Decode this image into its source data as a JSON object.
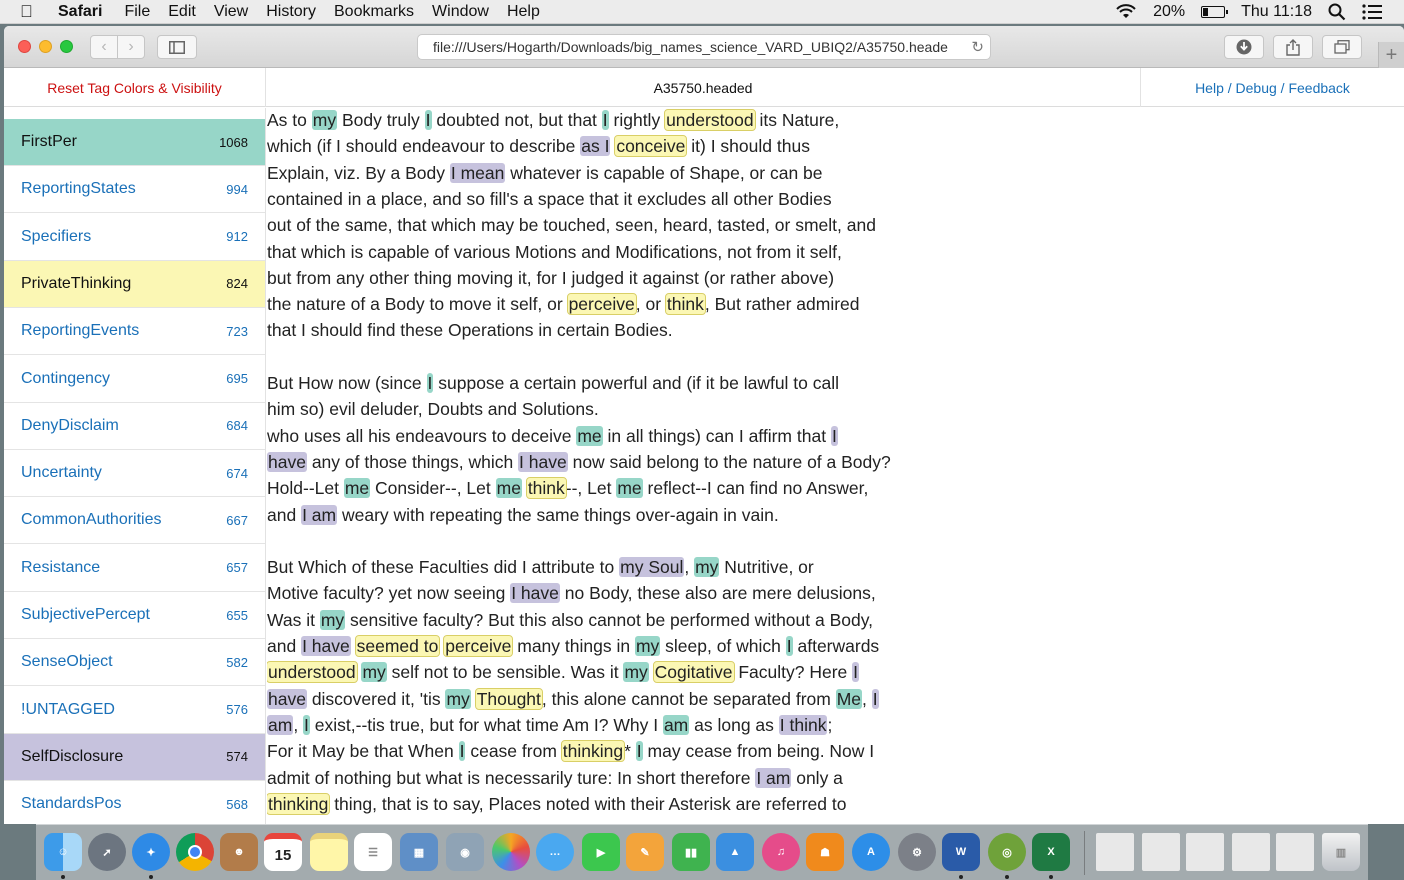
{
  "menubar": {
    "app": "Safari",
    "items": [
      "File",
      "Edit",
      "View",
      "History",
      "Bookmarks",
      "Window",
      "Help"
    ],
    "battery": "20%",
    "clock": "Thu 11:18"
  },
  "toolbar": {
    "url": "file:///Users/Hogarth/Downloads/big_names_science_VARD_UBIQ2/A35750.heade"
  },
  "page": {
    "reset_label": "Reset Tag Colors & Visibility",
    "title": "A35750.headed",
    "help_label": "Help / Debug / Feedback"
  },
  "colors": {
    "teal": "#97d6c8",
    "yellow": "#fbf7b4",
    "lavender": "#c6c2dd",
    "link": "#1a70b8",
    "reset": "#cc1111"
  },
  "tags": [
    {
      "name": "FirstPer",
      "count": "1068",
      "color": "#97d6c8"
    },
    {
      "name": "ReportingStates",
      "count": "994",
      "color": ""
    },
    {
      "name": "Specifiers",
      "count": "912",
      "color": ""
    },
    {
      "name": "PrivateThinking",
      "count": "824",
      "color": "#fbf7b4"
    },
    {
      "name": "ReportingEvents",
      "count": "723",
      "color": ""
    },
    {
      "name": "Contingency",
      "count": "695",
      "color": ""
    },
    {
      "name": "DenyDisclaim",
      "count": "684",
      "color": ""
    },
    {
      "name": "Uncertainty",
      "count": "674",
      "color": ""
    },
    {
      "name": "CommonAuthorities",
      "count": "667",
      "color": ""
    },
    {
      "name": "Resistance",
      "count": "657",
      "color": ""
    },
    {
      "name": "SubjectivePercept",
      "count": "655",
      "color": ""
    },
    {
      "name": "SenseObject",
      "count": "582",
      "color": ""
    },
    {
      "name": "!UNTAGGED",
      "count": "576",
      "color": ""
    },
    {
      "name": "SelfDisclosure",
      "count": "574",
      "color": "#c6c2dd"
    },
    {
      "name": "StandardsPos",
      "count": "568",
      "color": ""
    }
  ],
  "text_lines": [
    [
      [
        "As to ",
        ""
      ],
      [
        "my",
        "teal"
      ],
      [
        " Body truly ",
        ""
      ],
      [
        "I",
        "teal"
      ],
      [
        " doubted not, but that ",
        ""
      ],
      [
        "I",
        "teal"
      ],
      [
        " rightly ",
        ""
      ],
      [
        "understood",
        "yellow"
      ],
      [
        " its Nature,",
        ""
      ]
    ],
    [
      [
        "which (if I should endeavour to describe ",
        ""
      ],
      [
        "as I",
        "lav"
      ],
      [
        " ",
        ""
      ],
      [
        "conceive",
        "yellow"
      ],
      [
        " it) I should thus",
        ""
      ]
    ],
    [
      [
        "Explain, viz. By a Body ",
        ""
      ],
      [
        "I mean",
        "lav"
      ],
      [
        " whatever is capable of Shape, or can be",
        ""
      ]
    ],
    [
      [
        "contained in a place, and so fill's a space that it excludes all other Bodies",
        ""
      ]
    ],
    [
      [
        "out of the same, that which may be touched, seen, heard, tasted, or smelt, and",
        ""
      ]
    ],
    [
      [
        "that which is capable of various Motions and Modifications, not from it self,",
        ""
      ]
    ],
    [
      [
        "but from any other thing moving it, for I judged it against (or rather above)",
        ""
      ]
    ],
    [
      [
        "the nature of a Body to move it self, or ",
        ""
      ],
      [
        "perceive",
        "yellow"
      ],
      [
        ", or ",
        ""
      ],
      [
        "think",
        "yellow"
      ],
      [
        ", But rather admired",
        ""
      ]
    ],
    [
      [
        "that I should find these Operations in certain Bodies.",
        ""
      ]
    ],
    [],
    [
      [
        "But How now (since ",
        ""
      ],
      [
        "I",
        "teal"
      ],
      [
        " suppose a certain powerful and (if it be lawful to call",
        ""
      ]
    ],
    [
      [
        "him so) evil deluder, Doubts and Solutions.",
        ""
      ]
    ],
    [
      [
        "who uses all his endeavours to deceive ",
        ""
      ],
      [
        "me",
        "teal"
      ],
      [
        " in all things) can I affirm that ",
        ""
      ],
      [
        "I",
        "lav"
      ]
    ],
    [
      [
        "have",
        "lav"
      ],
      [
        " any of those things, which ",
        ""
      ],
      [
        "I have",
        "lav"
      ],
      [
        " now said belong to the nature of a Body?",
        ""
      ]
    ],
    [
      [
        "Hold--Let ",
        ""
      ],
      [
        "me",
        "teal"
      ],
      [
        " Consider--, Let ",
        ""
      ],
      [
        "me",
        "teal"
      ],
      [
        " ",
        ""
      ],
      [
        "think",
        "yellow"
      ],
      [
        "--, Let ",
        ""
      ],
      [
        "me",
        "teal"
      ],
      [
        " reflect--I can find no Answer,",
        ""
      ]
    ],
    [
      [
        "and ",
        ""
      ],
      [
        "I am",
        "lav"
      ],
      [
        " weary with repeating the same things over-again in vain.",
        ""
      ]
    ],
    [],
    [
      [
        "But Which of these Faculties did I attribute to ",
        ""
      ],
      [
        "my Soul",
        "lav"
      ],
      [
        ", ",
        ""
      ],
      [
        "my",
        "teal"
      ],
      [
        " Nutritive, or",
        ""
      ]
    ],
    [
      [
        "Motive faculty? yet now seeing ",
        ""
      ],
      [
        "I have",
        "lav"
      ],
      [
        " no Body, these also are mere delusions,",
        ""
      ]
    ],
    [
      [
        "Was it ",
        ""
      ],
      [
        "my",
        "teal"
      ],
      [
        " sensitive faculty? But this also cannot be performed without a Body,",
        ""
      ]
    ],
    [
      [
        "and ",
        ""
      ],
      [
        "I have",
        "lav"
      ],
      [
        " ",
        ""
      ],
      [
        "seemed to",
        "yellow"
      ],
      [
        " ",
        ""
      ],
      [
        "perceive",
        "yellow"
      ],
      [
        " many things in ",
        ""
      ],
      [
        "my",
        "teal"
      ],
      [
        " sleep, of which ",
        ""
      ],
      [
        "I",
        "teal"
      ],
      [
        " afterwards",
        ""
      ]
    ],
    [
      [
        "understood",
        "yellow"
      ],
      [
        " ",
        ""
      ],
      [
        "my",
        "teal"
      ],
      [
        " self not to be sensible. Was it ",
        ""
      ],
      [
        "my",
        "teal"
      ],
      [
        " ",
        ""
      ],
      [
        "Cogitative",
        "yellow"
      ],
      [
        " Faculty? Here ",
        ""
      ],
      [
        "I",
        "lav"
      ]
    ],
    [
      [
        "have",
        "lav"
      ],
      [
        " discovered it, 'tis ",
        ""
      ],
      [
        "my",
        "teal"
      ],
      [
        " ",
        ""
      ],
      [
        "Thought",
        "yellow"
      ],
      [
        ", this alone cannot be separated from ",
        ""
      ],
      [
        "Me",
        "teal"
      ],
      [
        ", ",
        ""
      ],
      [
        "I",
        "lav"
      ]
    ],
    [
      [
        "am",
        "lav"
      ],
      [
        ", ",
        ""
      ],
      [
        "I",
        "teal"
      ],
      [
        " exist,--tis true, but for what time Am I? Why I ",
        ""
      ],
      [
        "am",
        "teal"
      ],
      [
        " as long as ",
        ""
      ],
      [
        "I think",
        "lav"
      ],
      [
        ";",
        ""
      ]
    ],
    [
      [
        "For it May be that When ",
        ""
      ],
      [
        "I",
        "teal"
      ],
      [
        " cease from ",
        ""
      ],
      [
        "thinking",
        "yellow"
      ],
      [
        "* ",
        ""
      ],
      [
        "I",
        "teal"
      ],
      [
        " may cease from being. Now I",
        ""
      ]
    ],
    [
      [
        "admit of nothing but what is necessarily ture: In short therefore ",
        ""
      ],
      [
        "I am",
        "lav"
      ],
      [
        " only a",
        ""
      ]
    ],
    [
      [
        "thinking",
        "yellow"
      ],
      [
        " thing, that is to say, Places noted with their Asterisk are referred to",
        ""
      ]
    ]
  ]
}
